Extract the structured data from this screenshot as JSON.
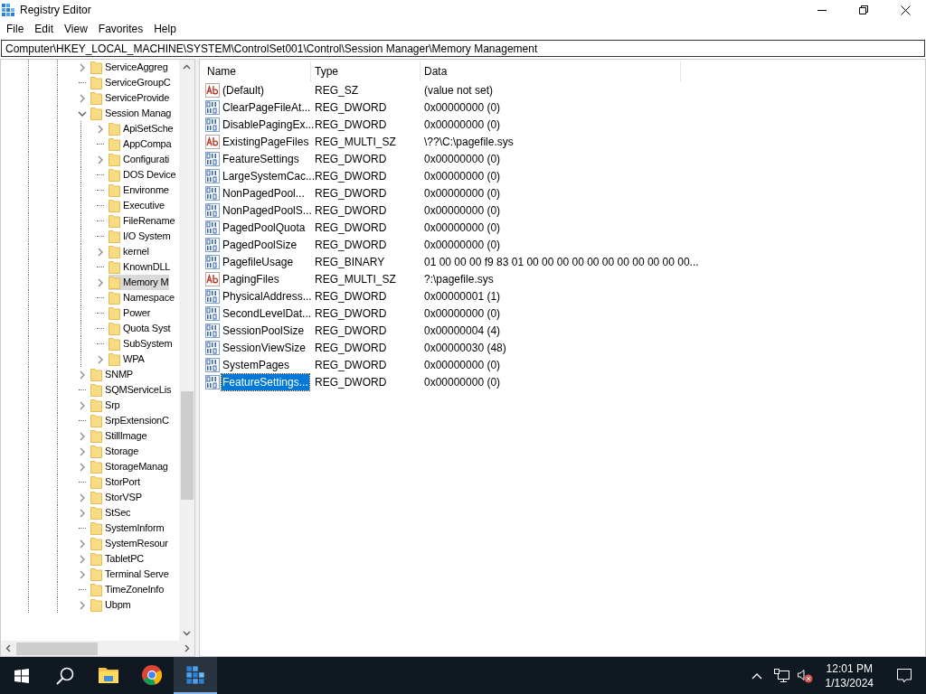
{
  "window": {
    "title": "Registry Editor"
  },
  "menu": [
    "File",
    "Edit",
    "View",
    "Favorites",
    "Help"
  ],
  "address": "Computer\\HKEY_LOCAL_MACHINE\\SYSTEM\\ControlSet001\\Control\\Session Manager\\Memory Management",
  "tree": [
    {
      "label": "ServiceAggreg",
      "expandable": true,
      "expanded": false,
      "selected": false
    },
    {
      "label": "ServiceGroupC",
      "expandable": false,
      "selected": false
    },
    {
      "label": "ServiceProvide",
      "expandable": true,
      "expanded": false,
      "selected": false
    },
    {
      "label": "Session Manag",
      "expandable": true,
      "expanded": true,
      "selected": false,
      "children": [
        {
          "label": "ApiSetSche",
          "expandable": true,
          "expanded": false,
          "selected": false
        },
        {
          "label": "AppCompa",
          "expandable": false,
          "selected": false
        },
        {
          "label": "Configurati",
          "expandable": true,
          "expanded": false,
          "selected": false
        },
        {
          "label": "DOS Device",
          "expandable": false,
          "selected": false
        },
        {
          "label": "Environme",
          "expandable": false,
          "selected": false
        },
        {
          "label": "Executive",
          "expandable": false,
          "selected": false
        },
        {
          "label": "FileRename",
          "expandable": false,
          "selected": false
        },
        {
          "label": "I/O System",
          "expandable": false,
          "selected": false
        },
        {
          "label": "kernel",
          "expandable": true,
          "expanded": false,
          "selected": false
        },
        {
          "label": "KnownDLL",
          "expandable": false,
          "selected": false
        },
        {
          "label": "Memory M",
          "expandable": true,
          "expanded": false,
          "selected": true
        },
        {
          "label": "Namespace",
          "expandable": false,
          "selected": false
        },
        {
          "label": "Power",
          "expandable": false,
          "selected": false
        },
        {
          "label": "Quota Syst",
          "expandable": false,
          "selected": false
        },
        {
          "label": "SubSystem",
          "expandable": false,
          "selected": false
        },
        {
          "label": "WPA",
          "expandable": true,
          "expanded": false,
          "selected": false
        }
      ]
    },
    {
      "label": "SNMP",
      "expandable": true,
      "expanded": false,
      "selected": false
    },
    {
      "label": "SQMServiceLis",
      "expandable": false,
      "selected": false
    },
    {
      "label": "Srp",
      "expandable": true,
      "expanded": false,
      "selected": false
    },
    {
      "label": "SrpExtensionC",
      "expandable": false,
      "selected": false
    },
    {
      "label": "StillImage",
      "expandable": true,
      "expanded": false,
      "selected": false
    },
    {
      "label": "Storage",
      "expandable": true,
      "expanded": false,
      "selected": false
    },
    {
      "label": "StorageManag",
      "expandable": true,
      "expanded": false,
      "selected": false
    },
    {
      "label": "StorPort",
      "expandable": false,
      "selected": false
    },
    {
      "label": "StorVSP",
      "expandable": true,
      "expanded": false,
      "selected": false
    },
    {
      "label": "StSec",
      "expandable": true,
      "expanded": false,
      "selected": false
    },
    {
      "label": "SystemInform",
      "expandable": false,
      "selected": false
    },
    {
      "label": "SystemResour",
      "expandable": true,
      "expanded": false,
      "selected": false
    },
    {
      "label": "TabletPC",
      "expandable": true,
      "expanded": false,
      "selected": false
    },
    {
      "label": "Terminal Serve",
      "expandable": true,
      "expanded": false,
      "selected": false
    },
    {
      "label": "TimeZoneInfo",
      "expandable": false,
      "selected": false
    },
    {
      "label": "Ubpm",
      "expandable": true,
      "expanded": false,
      "selected": false
    }
  ],
  "table": {
    "columns": [
      "Name",
      "Type",
      "Data"
    ],
    "rows": [
      {
        "kind": "string",
        "name": "(Default)",
        "type": "REG_SZ",
        "data": "(value not set)",
        "selected": false
      },
      {
        "kind": "binary",
        "name": "ClearPageFileAt...",
        "type": "REG_DWORD",
        "data": "0x00000000 (0)",
        "selected": false
      },
      {
        "kind": "binary",
        "name": "DisablePagingEx...",
        "type": "REG_DWORD",
        "data": "0x00000000 (0)",
        "selected": false
      },
      {
        "kind": "string",
        "name": "ExistingPageFiles",
        "type": "REG_MULTI_SZ",
        "data": "\\??\\C:\\pagefile.sys",
        "selected": false
      },
      {
        "kind": "binary",
        "name": "FeatureSettings",
        "type": "REG_DWORD",
        "data": "0x00000000 (0)",
        "selected": false
      },
      {
        "kind": "binary",
        "name": "LargeSystemCac...",
        "type": "REG_DWORD",
        "data": "0x00000000 (0)",
        "selected": false
      },
      {
        "kind": "binary",
        "name": "NonPagedPool...",
        "type": "REG_DWORD",
        "data": "0x00000000 (0)",
        "selected": false
      },
      {
        "kind": "binary",
        "name": "NonPagedPoolS...",
        "type": "REG_DWORD",
        "data": "0x00000000 (0)",
        "selected": false
      },
      {
        "kind": "binary",
        "name": "PagedPoolQuota",
        "type": "REG_DWORD",
        "data": "0x00000000 (0)",
        "selected": false
      },
      {
        "kind": "binary",
        "name": "PagedPoolSize",
        "type": "REG_DWORD",
        "data": "0x00000000 (0)",
        "selected": false
      },
      {
        "kind": "binary",
        "name": "PagefileUsage",
        "type": "REG_BINARY",
        "data": "01 00 00 00 f9 83 01 00 00 00 00 00 00 00 00 00 00 00...",
        "selected": false
      },
      {
        "kind": "string",
        "name": "PagingFiles",
        "type": "REG_MULTI_SZ",
        "data": "?:\\pagefile.sys",
        "selected": false
      },
      {
        "kind": "binary",
        "name": "PhysicalAddress...",
        "type": "REG_DWORD",
        "data": "0x00000001 (1)",
        "selected": false
      },
      {
        "kind": "binary",
        "name": "SecondLevelDat...",
        "type": "REG_DWORD",
        "data": "0x00000000 (0)",
        "selected": false
      },
      {
        "kind": "binary",
        "name": "SessionPoolSize",
        "type": "REG_DWORD",
        "data": "0x00000004 (4)",
        "selected": false
      },
      {
        "kind": "binary",
        "name": "SessionViewSize",
        "type": "REG_DWORD",
        "data": "0x00000030 (48)",
        "selected": false
      },
      {
        "kind": "binary",
        "name": "SystemPages",
        "type": "REG_DWORD",
        "data": "0x00000000 (0)",
        "selected": false
      },
      {
        "kind": "binary",
        "name": "FeatureSettings...",
        "type": "REG_DWORD",
        "data": "0x00000000 (0)",
        "selected": true
      }
    ]
  },
  "taskbar": {
    "apps": [
      {
        "kind": "explorer",
        "selected": false
      },
      {
        "kind": "chrome",
        "selected": false
      },
      {
        "kind": "regedit",
        "selected": true
      }
    ],
    "time": "12:01 PM",
    "date": "1/13/2024"
  }
}
